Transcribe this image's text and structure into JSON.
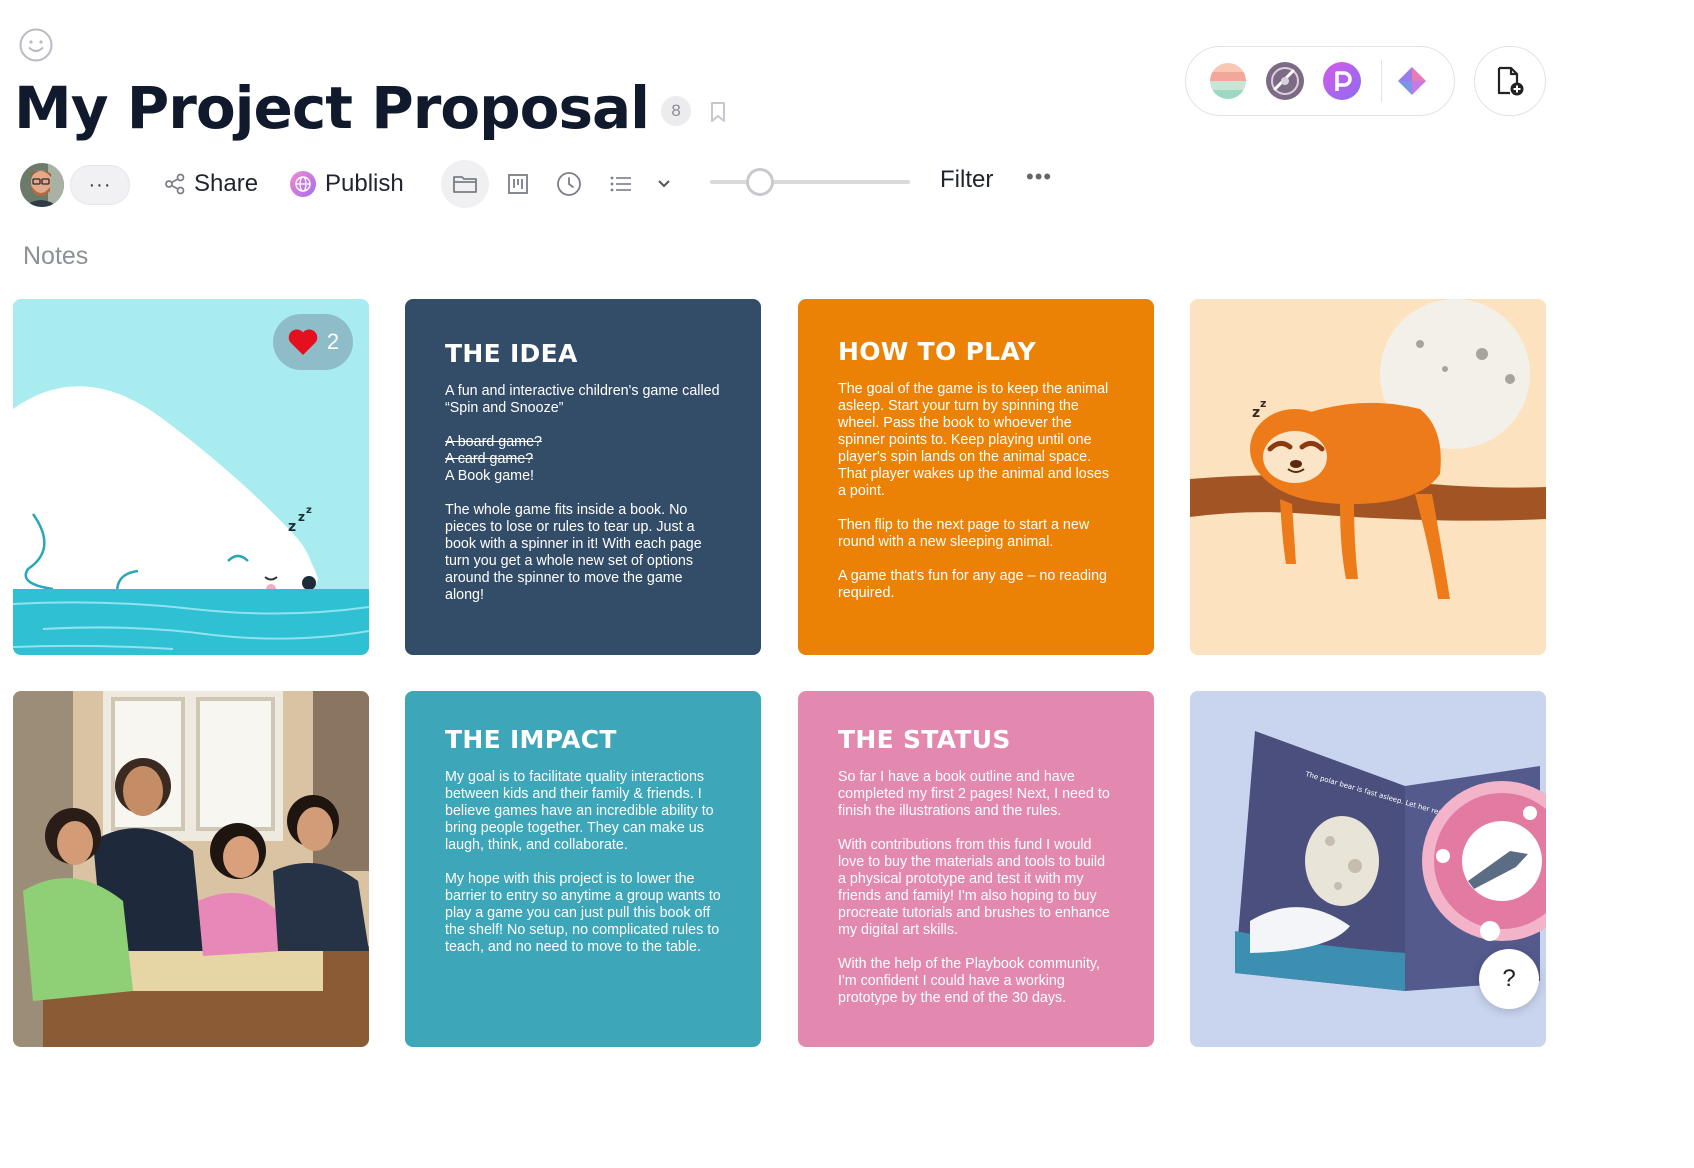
{
  "page": {
    "title": "My Project Proposal",
    "item_count": "8",
    "section_label": "Notes"
  },
  "toolbar": {
    "more_collaborators": "···",
    "share_label": "Share",
    "publish_label": "Publish",
    "filter_label": "Filter",
    "more_label": "•••",
    "views": [
      "folder-view",
      "board-view",
      "timeline-view",
      "list-view",
      "view-dropdown"
    ],
    "zoom_level": 0.25
  },
  "integrations": [
    "pastel-stripes-app",
    "vinyl-app",
    "p-app",
    "tri-color-app"
  ],
  "cards": {
    "polar_bear": {
      "like_count": "2"
    },
    "idea": {
      "color": "#334d68",
      "heading": "THE IDEA",
      "p1": "A fun and interactive children's game called “Spin and Snooze”",
      "strike1": "A board game?",
      "strike2": "A card game?",
      "plain": "A Book game!",
      "p3": "The whole game fits inside a book. No pieces to lose or rules to tear up. Just a book with a spinner in it! With each page turn you get a whole new set of options around the spinner to move the game along!"
    },
    "how_to_play": {
      "color": "#ec8205",
      "heading": "HOW TO PLAY",
      "p1": "The goal of the game is to keep the animal asleep. Start your turn by spinning the wheel. Pass the book to whoever the spinner points to. Keep playing until one player's spin lands on the animal space. That player wakes up the animal and loses a point.",
      "p2": "Then flip to the next page to start a new round with a new sleeping animal.",
      "p3": "A game that's fun for any age – no reading required."
    },
    "impact": {
      "color": "#3ea6b9",
      "heading": "THE IMPACT",
      "p1": "My goal is to facilitate quality interactions between kids and their family & friends. I believe games have an incredible ability to bring people together. They can make us laugh, think, and collaborate.",
      "p2": "My hope with this project is to lower the barrier to entry so anytime a group wants to play a game you can just pull this book off the shelf! No setup, no complicated rules to teach, and no need to move to the table."
    },
    "status": {
      "color": "#e389b0",
      "heading": "THE STATUS",
      "p1": "So far I have a book outline and have completed my first 2 pages! Next, I need to finish the illustrations and the rules.",
      "p2": "With contributions from this fund I would love to buy the materials and tools to build a physical prototype and test it with my friends and family! I'm also hoping to buy procreate tutorials and brushes to enhance my digital art skills.",
      "p3": "With the help of the Playbook community, I'm confident I could have a working prototype by the end of the 30 days."
    },
    "book_mockup": {
      "book_text": "The polar bear is fast asleep. Let her rest, don't make a peep."
    }
  },
  "help": {
    "label": "?"
  }
}
